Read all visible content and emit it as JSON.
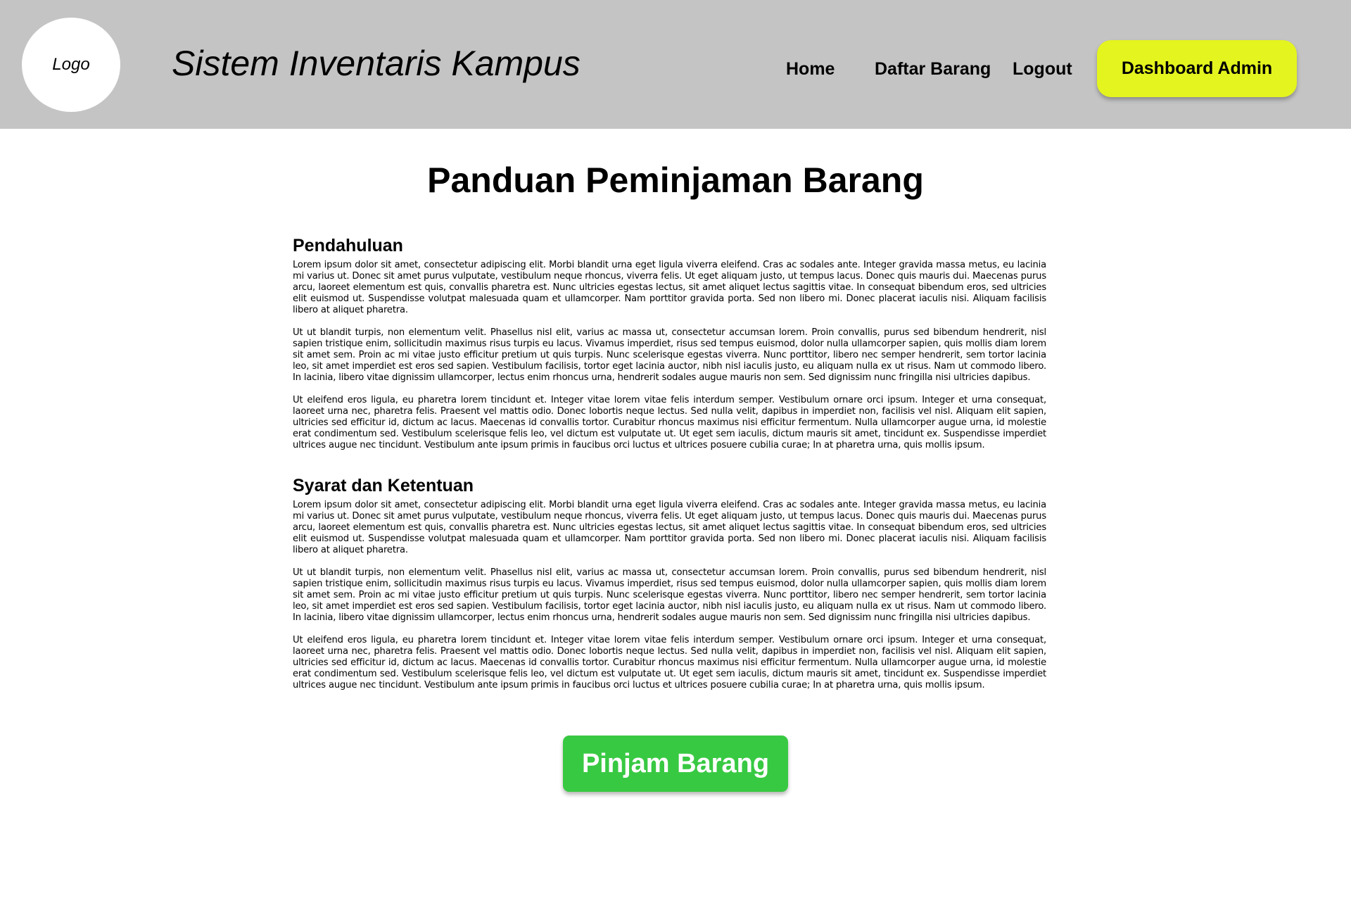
{
  "header": {
    "logo": "Logo",
    "title": "Sistem Inventaris Kampus",
    "nav": {
      "home": "Home",
      "daftar_barang": "Daftar Barang",
      "logout": "Logout"
    },
    "dashboard_button": "Dashboard Admin"
  },
  "main": {
    "title": "Panduan Peminjaman Barang",
    "sections": [
      {
        "heading": "Pendahuluan",
        "paragraphs": [
          "Lorem ipsum dolor sit amet, consectetur adipiscing elit. Morbi blandit urna eget ligula viverra eleifend. Cras ac sodales ante. Integer gravida massa metus, eu lacinia mi varius ut. Donec sit amet purus vulputate, vestibulum neque rhoncus, viverra felis. Ut eget aliquam justo, ut tempus lacus. Donec quis mauris dui. Maecenas purus arcu, laoreet elementum est quis, convallis pharetra est. Nunc ultricies egestas lectus, sit amet aliquet lectus sagittis vitae. In consequat bibendum eros, sed ultricies elit euismod ut. Suspendisse volutpat malesuada quam et ullamcorper. Nam porttitor gravida porta. Sed non libero mi. Donec placerat iaculis nisi. Aliquam facilisis libero at aliquet pharetra.",
          "Ut ut blandit turpis, non elementum velit. Phasellus nisl elit, varius ac massa ut, consectetur accumsan lorem. Proin convallis, purus sed bibendum hendrerit, nisl sapien tristique enim, sollicitudin maximus risus turpis eu lacus. Vivamus imperdiet, risus sed tempus euismod, dolor nulla ullamcorper sapien, quis mollis diam lorem sit amet sem. Proin ac mi vitae justo efficitur pretium ut quis turpis. Nunc scelerisque egestas viverra. Nunc porttitor, libero nec semper hendrerit, sem tortor lacinia leo, sit amet imperdiet est eros sed sapien. Vestibulum facilisis, tortor eget lacinia auctor, nibh nisl iaculis justo, eu aliquam nulla ex ut risus. Nam ut commodo libero. In lacinia, libero vitae dignissim ullamcorper, lectus enim rhoncus urna, hendrerit sodales augue mauris non sem. Sed dignissim nunc fringilla nisi ultricies dapibus.",
          "Ut eleifend eros ligula, eu pharetra lorem tincidunt et. Integer vitae lorem vitae felis interdum semper. Vestibulum ornare orci ipsum. Integer et urna consequat, laoreet urna nec, pharetra felis. Praesent vel mattis odio. Donec lobortis neque lectus. Sed nulla velit, dapibus in imperdiet non, facilisis vel nisl. Aliquam elit sapien, ultricies sed efficitur id, dictum ac lacus. Maecenas id convallis tortor. Curabitur rhoncus maximus nisi efficitur fermentum. Nulla ullamcorper augue urna, id molestie erat condimentum sed. Vestibulum scelerisque felis leo, vel dictum est vulputate ut. Ut eget sem iaculis, dictum mauris sit amet, tincidunt ex. Suspendisse imperdiet ultrices augue nec tincidunt. Vestibulum ante ipsum primis in faucibus orci luctus et ultrices posuere cubilia curae; In at pharetra urna, quis mollis ipsum."
        ]
      },
      {
        "heading": "Syarat dan Ketentuan",
        "paragraphs": [
          "Lorem ipsum dolor sit amet, consectetur adipiscing elit. Morbi blandit urna eget ligula viverra eleifend. Cras ac sodales ante. Integer gravida massa metus, eu lacinia mi varius ut. Donec sit amet purus vulputate, vestibulum neque rhoncus, viverra felis. Ut eget aliquam justo, ut tempus lacus. Donec quis mauris dui. Maecenas purus arcu, laoreet elementum est quis, convallis pharetra est. Nunc ultricies egestas lectus, sit amet aliquet lectus sagittis vitae. In consequat bibendum eros, sed ultricies elit euismod ut. Suspendisse volutpat malesuada quam et ullamcorper. Nam porttitor gravida porta. Sed non libero mi. Donec placerat iaculis nisi. Aliquam facilisis libero at aliquet pharetra.",
          "Ut ut blandit turpis, non elementum velit. Phasellus nisl elit, varius ac massa ut, consectetur accumsan lorem. Proin convallis, purus sed bibendum hendrerit, nisl sapien tristique enim, sollicitudin maximus risus turpis eu lacus. Vivamus imperdiet, risus sed tempus euismod, dolor nulla ullamcorper sapien, quis mollis diam lorem sit amet sem. Proin ac mi vitae justo efficitur pretium ut quis turpis. Nunc scelerisque egestas viverra. Nunc porttitor, libero nec semper hendrerit, sem tortor lacinia leo, sit amet imperdiet est eros sed sapien. Vestibulum facilisis, tortor eget lacinia auctor, nibh nisl iaculis justo, eu aliquam nulla ex ut risus. Nam ut commodo libero. In lacinia, libero vitae dignissim ullamcorper, lectus enim rhoncus urna, hendrerit sodales augue mauris non sem. Sed dignissim nunc fringilla nisi ultricies dapibus.",
          "Ut eleifend eros ligula, eu pharetra lorem tincidunt et. Integer vitae lorem vitae felis interdum semper. Vestibulum ornare orci ipsum. Integer et urna consequat, laoreet urna nec, pharetra felis. Praesent vel mattis odio. Donec lobortis neque lectus. Sed nulla velit, dapibus in imperdiet non, facilisis vel nisl. Aliquam elit sapien, ultricies sed efficitur id, dictum ac lacus. Maecenas id convallis tortor. Curabitur rhoncus maximus nisi efficitur fermentum. Nulla ullamcorper augue urna, id molestie erat condimentum sed. Vestibulum scelerisque felis leo, vel dictum est vulputate ut. Ut eget sem iaculis, dictum mauris sit amet, tincidunt ex. Suspendisse imperdiet ultrices augue nec tincidunt. Vestibulum ante ipsum primis in faucibus orci luctus et ultrices posuere cubilia curae; In at pharetra urna, quis mollis ipsum."
        ]
      }
    ],
    "action_button": "Pinjam Barang"
  },
  "colors": {
    "header_bg": "#c4c4c4",
    "dashboard_button": "#e4f41e",
    "action_button": "#38c942"
  }
}
